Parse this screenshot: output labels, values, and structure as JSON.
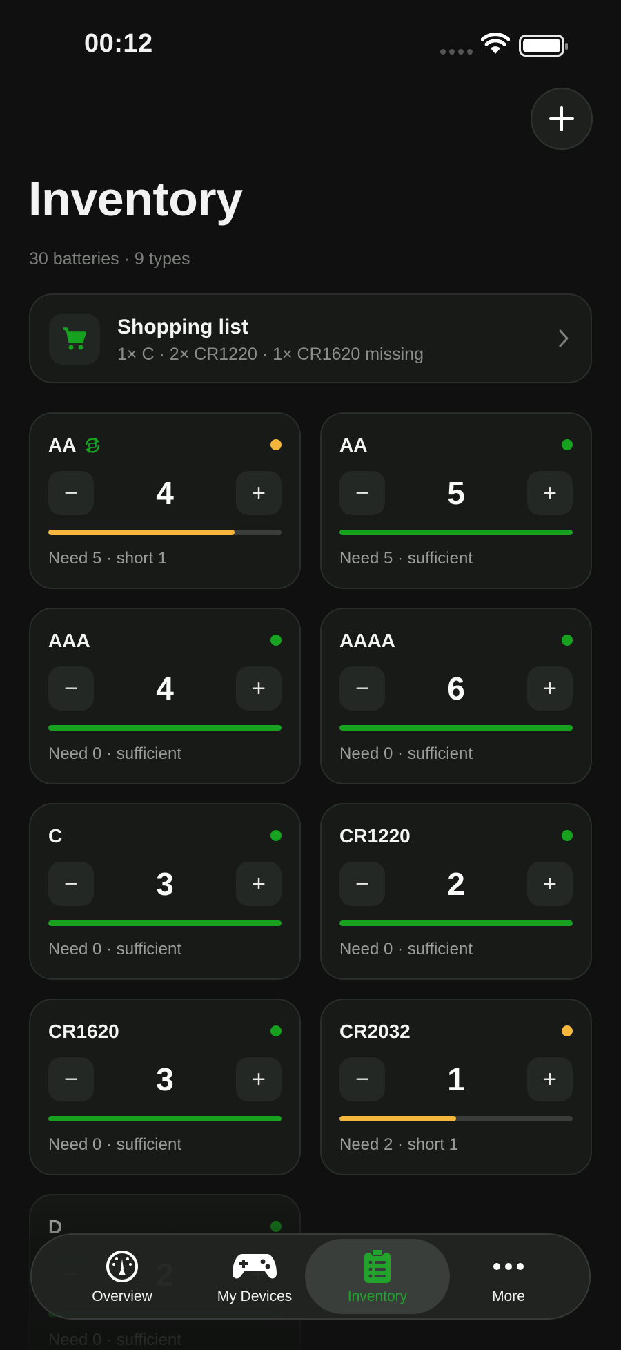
{
  "status_bar": {
    "time": "00:12"
  },
  "header": {
    "title": "Inventory",
    "subtitle": "30 batteries · 9 types"
  },
  "shopping": {
    "title": "Shopping list",
    "detail": "1× C · 2× CR1220 · 1× CR1620 missing"
  },
  "colors": {
    "green": "#16a21f",
    "amber": "#f4b73c",
    "background": "#0f100f",
    "card": "#171a17"
  },
  "cards": [
    {
      "name": "AA",
      "rechargeable": true,
      "count": "4",
      "status": "Need 5 · short 1",
      "fill": 0.8,
      "color": "#f4b73c"
    },
    {
      "name": "AA",
      "rechargeable": false,
      "count": "5",
      "status": "Need 5 · sufficient",
      "fill": 1,
      "color": "#16a21f"
    },
    {
      "name": "AAA",
      "rechargeable": false,
      "count": "4",
      "status": "Need 0 · sufficient",
      "fill": 1,
      "color": "#16a21f"
    },
    {
      "name": "AAAA",
      "rechargeable": false,
      "count": "6",
      "status": "Need 0 · sufficient",
      "fill": 1,
      "color": "#16a21f"
    },
    {
      "name": "C",
      "rechargeable": false,
      "count": "3",
      "status": "Need 0 · sufficient",
      "fill": 1,
      "color": "#16a21f"
    },
    {
      "name": "CR1220",
      "rechargeable": false,
      "count": "2",
      "status": "Need 0 · sufficient",
      "fill": 1,
      "color": "#16a21f"
    },
    {
      "name": "CR1620",
      "rechargeable": false,
      "count": "3",
      "status": "Need 0 · sufficient",
      "fill": 1,
      "color": "#16a21f"
    },
    {
      "name": "CR2032",
      "rechargeable": false,
      "count": "1",
      "status": "Need 2 · short 1",
      "fill": 0.5,
      "color": "#f4b73c"
    },
    {
      "name": "D",
      "rechargeable": false,
      "count": "2",
      "status": "Need 0 · sufficient",
      "fill": 1,
      "color": "#16a21f"
    }
  ],
  "stepper": {
    "minus": "−",
    "plus": "+"
  },
  "tabs": [
    {
      "label": "Overview",
      "icon": "gauge-icon"
    },
    {
      "label": "My Devices",
      "icon": "gamepad-icon"
    },
    {
      "label": "Inventory",
      "icon": "clipboard-list-icon",
      "active": true
    },
    {
      "label": "More",
      "icon": "ellipsis-icon"
    }
  ]
}
